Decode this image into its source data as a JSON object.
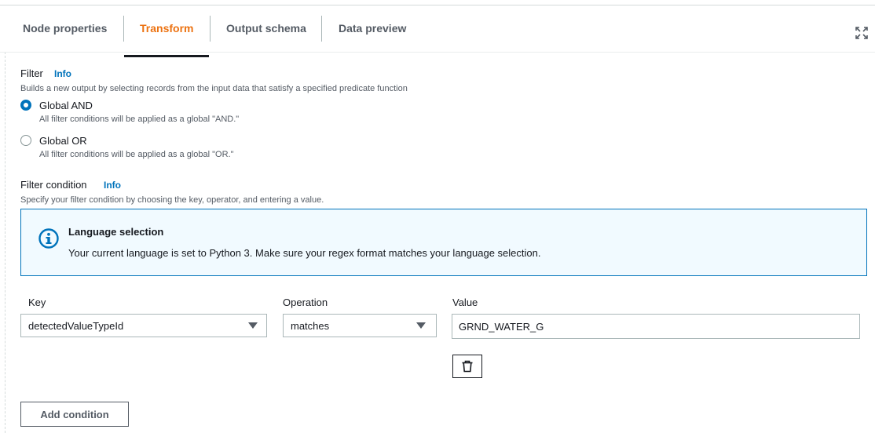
{
  "tabs": [
    {
      "label": "Node properties",
      "active": false
    },
    {
      "label": "Transform",
      "active": true
    },
    {
      "label": "Output schema",
      "active": false
    },
    {
      "label": "Data preview",
      "active": false
    }
  ],
  "filter": {
    "title": "Filter",
    "info": "Info",
    "description": "Builds a new output by selecting records from the input data that satisfy a specified predicate function",
    "options": [
      {
        "label": "Global AND",
        "description": "All filter conditions will be applied as a global \"AND.\"",
        "selected": true
      },
      {
        "label": "Global OR",
        "description": "All filter conditions will be applied as a global \"OR.\"",
        "selected": false
      }
    ]
  },
  "filter_condition": {
    "title": "Filter condition",
    "info": "Info",
    "description": "Specify your filter condition by choosing the key, operator, and entering a value."
  },
  "alert": {
    "icon": "info-circle-icon",
    "title": "Language selection",
    "text": "Your current language is set to Python 3. Make sure your regex format matches your language selection.",
    "color": "#0073bb",
    "background": "#f1faff"
  },
  "condition": {
    "key_label": "Key",
    "key_value": "detectedValueTypeId",
    "operation_label": "Operation",
    "operation_value": "matches",
    "value_label": "Value",
    "value_value": "GRND_WATER_G"
  },
  "buttons": {
    "add_condition": "Add condition",
    "remove_icon": "trash-icon"
  },
  "colors": {
    "active_tab": "#ec7211",
    "link": "#0073bb"
  }
}
